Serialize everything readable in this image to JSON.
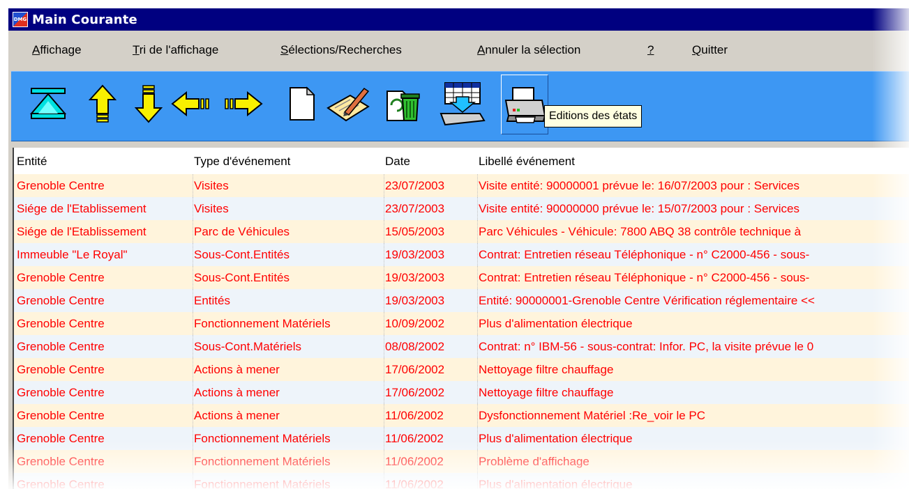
{
  "window": {
    "title": "Main Courante",
    "icon_text": "DMG"
  },
  "menu": [
    {
      "pre": "",
      "u": "A",
      "post": "ffichage"
    },
    {
      "pre": "",
      "u": "T",
      "post": "ri de l'affichage"
    },
    {
      "pre": "",
      "u": "S",
      "post": "élections/Recherches"
    },
    {
      "pre": "",
      "u": "A",
      "post": "nnuler la sélection"
    },
    {
      "pre": "",
      "u": "?",
      "post": ""
    },
    {
      "pre": "",
      "u": "Q",
      "post": "uitter"
    }
  ],
  "toolbar": {
    "buttons": [
      {
        "icon": "first-record-icon"
      },
      {
        "icon": "arrow-up-icon"
      },
      {
        "icon": "arrow-down-icon"
      },
      {
        "icon": "arrow-left-icon"
      },
      {
        "icon": "arrow-right-icon"
      },
      {
        "icon": "new-document-icon"
      },
      {
        "icon": "edit-document-icon"
      },
      {
        "icon": "delete-trash-icon"
      },
      {
        "icon": "export-table-icon"
      },
      {
        "icon": "print-icon"
      }
    ],
    "tooltip": "Editions des états"
  },
  "grid": {
    "columns": [
      "Entité",
      "Type d'événement",
      "Date",
      "Libellé événement"
    ],
    "rows": [
      [
        "Grenoble Centre",
        "Visites",
        "23/07/2003",
        "Visite entité: 90000001 prévue le: 16/07/2003 pour : Services"
      ],
      [
        "Siége de l'Etablissement",
        "Visites",
        "23/07/2003",
        "Visite entité: 90000000 prévue le: 15/07/2003 pour : Services"
      ],
      [
        "Siége de l'Etablissement",
        "Parc de Véhicules",
        "15/05/2003",
        "Parc Véhicules - Véhicule: 7800 ABQ 38 contrôle technique à"
      ],
      [
        "Immeuble \"Le Royal\"",
        "Sous-Cont.Entités",
        "19/03/2003",
        "Contrat: Entretien réseau Téléphonique - n° C2000-456 - sous-"
      ],
      [
        "Grenoble Centre",
        "Sous-Cont.Entités",
        "19/03/2003",
        "Contrat: Entretien réseau Téléphonique - n° C2000-456 - sous-"
      ],
      [
        "Grenoble Centre",
        "Entités",
        "19/03/2003",
        "Entité: 90000001-Grenoble Centre Vérification réglementaire <<"
      ],
      [
        "Grenoble Centre",
        "Fonctionnement Matériels",
        "10/09/2002",
        "Plus d'alimentation électrique"
      ],
      [
        "Grenoble Centre",
        "Sous-Cont.Matériels",
        "08/08/2002",
        "Contrat: n° IBM-56 - sous-contrat: Infor. PC, la visite prévue le 0"
      ],
      [
        "Grenoble Centre",
        "Actions à mener",
        "17/06/2002",
        "Nettoyage filtre chauffage"
      ],
      [
        "Grenoble Centre",
        "Actions à mener",
        "17/06/2002",
        "Nettoyage filtre chauffage"
      ],
      [
        "Grenoble Centre",
        "Actions à mener",
        "11/06/2002",
        "Dysfonctionnement Matériel :Re_voir le PC"
      ],
      [
        "Grenoble Centre",
        "Fonctionnement Matériels",
        "11/06/2002",
        "Plus d'alimentation électrique"
      ],
      [
        "Grenoble Centre",
        "Fonctionnement Matériels",
        "11/06/2002",
        "Problème d'affichage"
      ],
      [
        "Grenoble Centre",
        "Fonctionnement Matériels",
        "11/06/2002",
        "Plus d'alimentation électrique"
      ]
    ]
  },
  "colors": {
    "title_bar": "#000080",
    "toolbar": "#3d97f3",
    "row_text": "#ff0000",
    "icon_yellow": "#f8f000",
    "icon_cyan": "#00e0e0"
  }
}
